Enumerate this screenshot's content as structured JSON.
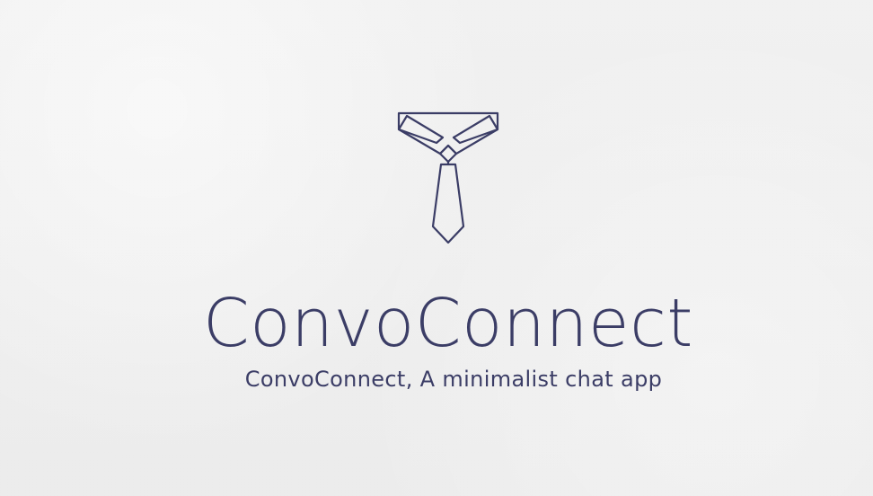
{
  "brand": {
    "title": "ConvoConnect",
    "tagline": "ConvoConnect, A minimalist chat app",
    "logo_icon": "tie-collar-icon"
  },
  "colors": {
    "background": "#efefef",
    "brand": "#3b3d66"
  }
}
